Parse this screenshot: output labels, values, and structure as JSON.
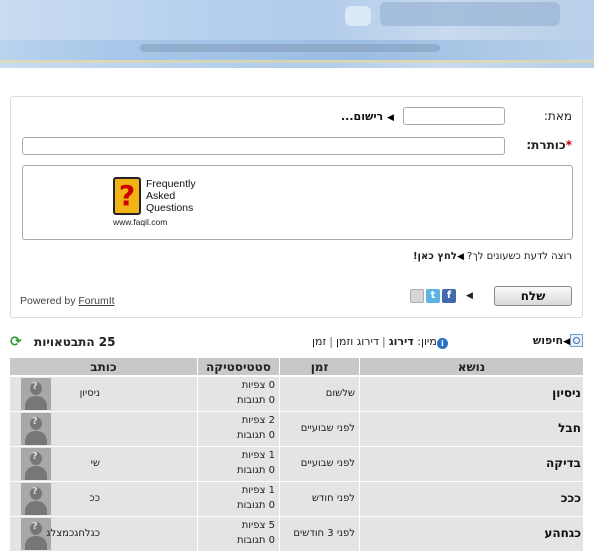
{
  "form": {
    "from_label": "מאת:",
    "register_link": "רישום...",
    "subject_label": "כותרת:",
    "required_mark": "*",
    "faq_text": "Frequently Asked Questions",
    "faq_url": "www.faqil.com",
    "notify_text": "רוצה לדעת כשעונים לך?",
    "notify_link": "לחץ כאן!",
    "powered_prefix": "Powered by",
    "powered_link": "ForumIt",
    "send_button": "שלח"
  },
  "toolbar": {
    "search_label": "חיפוש",
    "sort_label": "מיון:",
    "sort_options": [
      "דירוג",
      "דירוג וזמן",
      "זמן"
    ],
    "replies_count": "25 התבטאויות"
  },
  "table": {
    "headers": {
      "topic": "נושא",
      "time": "זמן",
      "stats": "סטטיסטיקה",
      "writer": "כותב"
    },
    "rows": [
      {
        "topic": "ניסיון",
        "time": "שלשום",
        "views": "0 צפיות",
        "replies": "0 תגובות",
        "writer": "ניסיון"
      },
      {
        "topic": "חבל",
        "time": "לפני שבועיים",
        "views": "2 צפיות",
        "replies": "0 תגובות",
        "writer": ""
      },
      {
        "topic": "בדיקה",
        "time": "לפני שבועיים",
        "views": "1 צפיות",
        "replies": "0 תגובות",
        "writer": "שי"
      },
      {
        "topic": "כככ",
        "time": "לפני חודש",
        "views": "1 צפיות",
        "replies": "0 תגובות",
        "writer": "ככ"
      },
      {
        "topic": "כגחהע",
        "time": "לפני 3 חודשים",
        "views": "5 צפיות",
        "replies": "0 תגובות",
        "writer": "כגלחגכמצלג"
      }
    ]
  },
  "colors": {
    "banner": "#b5d0ee",
    "table_header": "#c8c8c8",
    "table_row": "#e4e4e4",
    "required": "#cc0000",
    "info_icon": "#2b6fc4",
    "refresh_icon": "#2e9b2e"
  },
  "icons": [
    "question-mark-faq-icon",
    "mail-icon",
    "twitter-icon",
    "facebook-icon",
    "refresh-icon",
    "info-icon",
    "search-icon",
    "avatar-placeholder-icon"
  ]
}
